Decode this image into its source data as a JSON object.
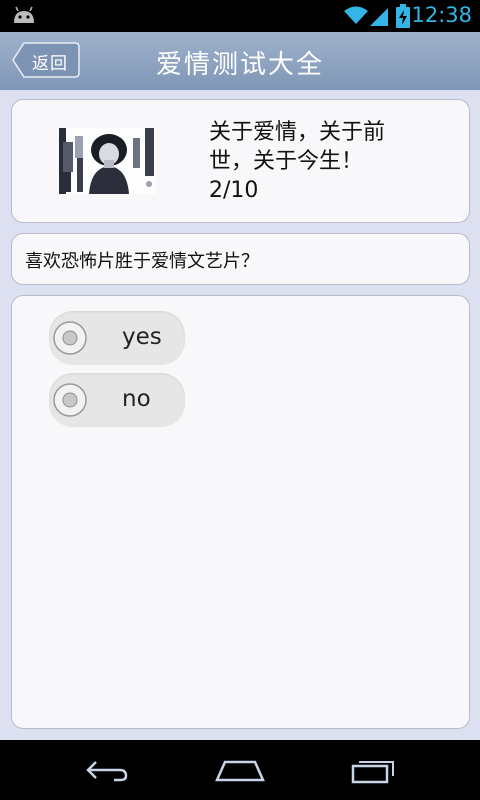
{
  "status_bar": {
    "time": "12:38",
    "icons": [
      "android-icon",
      "wifi-icon",
      "signal-icon",
      "battery-charging-icon"
    ],
    "accent_color": "#33b5e5"
  },
  "title_bar": {
    "back_label": "返回",
    "title": "爱情测试大全"
  },
  "header": {
    "line1": "关于爱情，关于前",
    "line2": "世，关于今生！",
    "progress": "2/10"
  },
  "question": {
    "text": "喜欢恐怖片胜于爱情文艺片？"
  },
  "options": [
    {
      "label": "yes",
      "selected": false
    },
    {
      "label": "no",
      "selected": false
    }
  ],
  "nav_bar": {
    "icons": [
      "back-icon",
      "home-icon",
      "recent-apps-icon"
    ]
  }
}
